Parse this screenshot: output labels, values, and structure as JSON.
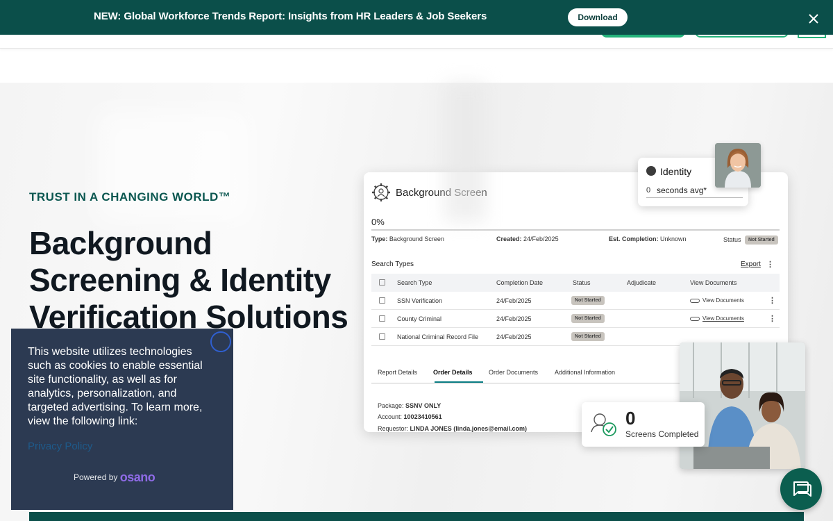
{
  "banner": {
    "text": "NEW: Global Workforce Trends Report: Insights from HR Leaders & Job Seekers",
    "button_label": "Download",
    "close_icon": "close-icon"
  },
  "hero": {
    "eyebrow": "TRUST IN A CHANGING WORLD™",
    "headline": "Background Screening & Identity Verification Solutions"
  },
  "card": {
    "title": "Background Screen",
    "progress": "0%",
    "type_label": "Type:",
    "type_value": "Background Screen",
    "created_label": "Created:",
    "created_value": "24/Feb/2025",
    "est_label": "Est. Completion:",
    "est_value": "Unknown",
    "status_label": "Status",
    "status_value": "Not Started",
    "search_types_title": "Search Types",
    "export_label": "Export",
    "columns": [
      "Search Type",
      "Completion Date",
      "Status",
      "Adjudicate",
      "View Documents"
    ],
    "rows": [
      {
        "search_type": "SSN Verification",
        "date": "24/Feb/2025",
        "status": "Not Started",
        "view_docs": "View Documents",
        "underlined": false
      },
      {
        "search_type": "County Criminal",
        "date": "24/Feb/2025",
        "status": "Not Started",
        "view_docs": "View Documents",
        "underlined": true
      },
      {
        "search_type": "National Criminal Record File",
        "date": "24/Feb/2025",
        "status": "Not Started",
        "view_docs": "",
        "underlined": false
      }
    ],
    "tabs": [
      "Report Details",
      "Order Details",
      "Order Documents",
      "Additional Information"
    ],
    "active_tab": "Order Details",
    "package_label": "Package:",
    "package_value": "SSNV ONLY",
    "account_label": "Account:",
    "account_value": "10023410561",
    "requestor_label": "Requestor:",
    "requestor_value": "LINDA JONES (linda.jones@email.com)"
  },
  "identity": {
    "title": "Identity",
    "count": "0",
    "label": "seconds avg*"
  },
  "screens": {
    "count": "0",
    "label": "Screens Completed"
  },
  "cookie": {
    "text": "This website utilizes technologies such as cookies to enable essential site functionality, as well as for analytics, personalization, and targeted advertising. To learn more, view the following link:",
    "link": "Privacy Policy",
    "powered_by": "Powered by",
    "brand": "osano"
  },
  "colors": {
    "brand_dark": "#0b4f4a",
    "accent_green": "#23b27a",
    "cookie_bg": "#2c3a52"
  }
}
